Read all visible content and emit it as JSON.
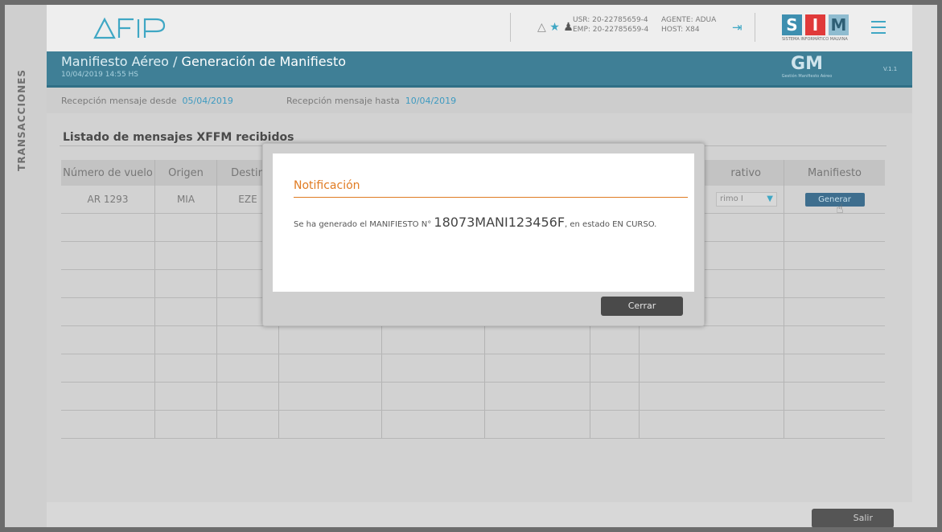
{
  "header": {
    "logo_text": "AFIP",
    "usr": "USR: 20-22785659-4",
    "emp": "EMP: 20-22785659-4",
    "agente": "AGENTE: ADUA",
    "host": "HOST:   X84",
    "sim": {
      "s": "S",
      "i": "I",
      "m": "M",
      "tagline": "SISTEMA INFORMÁTICO MALVINA"
    }
  },
  "sidebar": {
    "label": "TRANSACCIONES"
  },
  "titlebar": {
    "title_prefix": "Manifiesto Aéreo /",
    "title_main": "Generación de Manifiesto",
    "timestamp": "10/04/2019 14:55 HS",
    "module_code": "GM",
    "module_name": "Gestión Manifiesto Aéreo",
    "version": "V.1.1"
  },
  "filters": {
    "desde_label": "Recepción mensaje desde",
    "desde_value": "05/04/2019",
    "hasta_label": "Recepción mensaje hasta",
    "hasta_value": "10/04/2019"
  },
  "list": {
    "title": "Listado de mensajes XFFM recibidos",
    "columns": [
      "Número de vuelo",
      "Origen",
      "Destin",
      "",
      "",
      "",
      "",
      "rativo",
      "Manifiesto"
    ],
    "row": {
      "vuelo": "AR 1293",
      "origen": "MIA",
      "destino": "EZE",
      "select_value": "rimo I",
      "action": "Generar"
    }
  },
  "modal": {
    "title": "Notificación",
    "message_pre": "Se ha generado el MANIFIESTO N°",
    "manifest_number": "18073MANI123456F",
    "message_post": ", en estado EN CURSO.",
    "close": "Cerrar"
  },
  "footer": {
    "exit": "Salir"
  },
  "colors": {
    "accent": "#3fa7c4",
    "titlebar": "#3f7f96",
    "notify": "#e07b22"
  }
}
